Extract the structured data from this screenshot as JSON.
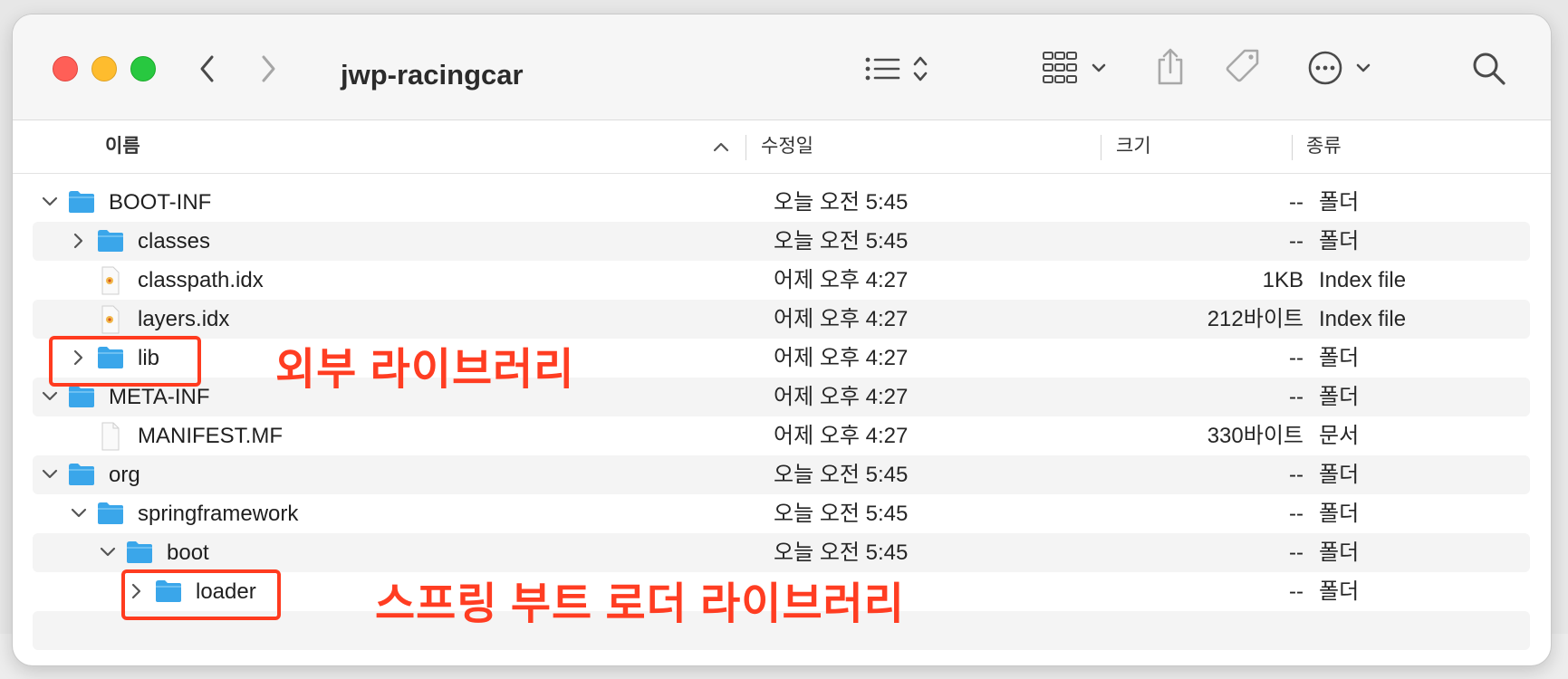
{
  "window": {
    "title": "jwp-racingcar"
  },
  "toolbar": {
    "back": "chevron-left-icon",
    "forward": "chevron-right-icon",
    "list_view": "list-view-icon",
    "grid_view": "grid-view-icon",
    "share": "share-icon",
    "tag": "tag-icon",
    "more": "more-icon",
    "search": "search-icon"
  },
  "columns": {
    "name": "이름",
    "modified": "수정일",
    "size": "크기",
    "kind": "종류"
  },
  "rows": [
    {
      "name": "BOOT-INF",
      "modified": "오늘 오전 5:45",
      "size": "--",
      "kind": "폴더"
    },
    {
      "name": "classes",
      "modified": "오늘 오전 5:45",
      "size": "--",
      "kind": "폴더"
    },
    {
      "name": "classpath.idx",
      "modified": "어제 오후 4:27",
      "size": "1KB",
      "kind": "Index file"
    },
    {
      "name": "layers.idx",
      "modified": "어제 오후 4:27",
      "size": "212바이트",
      "kind": "Index file"
    },
    {
      "name": "lib",
      "modified": "어제 오후 4:27",
      "size": "--",
      "kind": "폴더"
    },
    {
      "name": "META-INF",
      "modified": "어제 오후 4:27",
      "size": "--",
      "kind": "폴더"
    },
    {
      "name": "MANIFEST.MF",
      "modified": "어제 오후 4:27",
      "size": "330바이트",
      "kind": "문서"
    },
    {
      "name": "org",
      "modified": "오늘 오전 5:45",
      "size": "--",
      "kind": "폴더"
    },
    {
      "name": "springframework",
      "modified": "오늘 오전 5:45",
      "size": "--",
      "kind": "폴더"
    },
    {
      "name": "boot",
      "modified": "오늘 오전 5:45",
      "size": "--",
      "kind": "폴더"
    },
    {
      "name": "loader",
      "modified": "",
      "size": "--",
      "kind": "폴더"
    }
  ],
  "annotations": {
    "lib": "외부 라이브러리",
    "loader": "스프링 부트 로더 라이브러리"
  },
  "colors": {
    "folder": "#3aa6ea",
    "annotation": "#ff3d22",
    "close": "#ff5f57",
    "minimize": "#febc2e",
    "zoom": "#28c840"
  }
}
